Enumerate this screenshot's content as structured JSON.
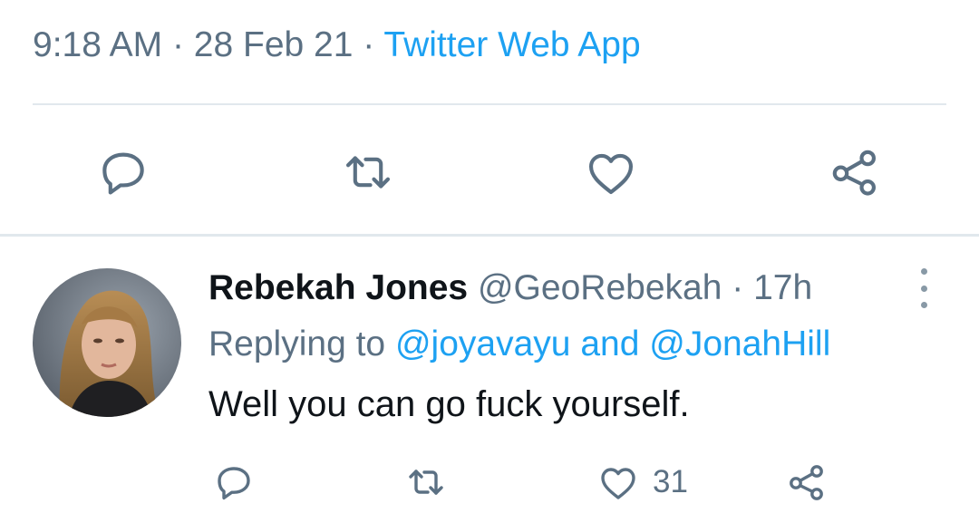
{
  "tweet": {
    "time": "9:18 AM",
    "separator": "·",
    "date": "28 Feb 21",
    "source": "Twitter Web App"
  },
  "actions": {
    "icons": [
      "reply-icon",
      "retweet-icon",
      "like-icon",
      "share-icon"
    ]
  },
  "reply": {
    "display_name": "Rebekah Jones",
    "handle": "@GeoRebekah",
    "separator": "·",
    "age": "17h",
    "replying_prefix": "Replying to",
    "mention_1": "@joyavayu",
    "conjunction": "and",
    "mention_2": "@JonahHill",
    "text": "Well you can go fuck yourself.",
    "like_count": "31"
  },
  "colors": {
    "link": "#1da1f2",
    "secondary_text": "#5b7083",
    "icon": "#5b7083",
    "divider": "#e1e8ed"
  }
}
